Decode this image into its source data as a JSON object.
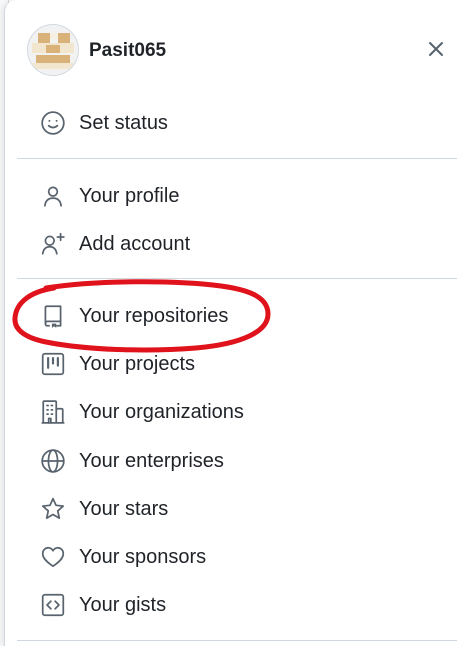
{
  "user": {
    "username": "Pasit065"
  },
  "menu": {
    "status": {
      "label": "Set status",
      "icon": "smiley-icon"
    },
    "section1": [
      {
        "label": "Your profile",
        "icon": "person-icon"
      },
      {
        "label": "Add account",
        "icon": "person-add-icon"
      }
    ],
    "section2": [
      {
        "label": "Your repositories",
        "icon": "repo-icon"
      },
      {
        "label": "Your projects",
        "icon": "project-icon"
      },
      {
        "label": "Your organizations",
        "icon": "organization-icon"
      },
      {
        "label": "Your enterprises",
        "icon": "globe-icon"
      },
      {
        "label": "Your stars",
        "icon": "star-icon"
      },
      {
        "label": "Your sponsors",
        "icon": "heart-icon"
      },
      {
        "label": "Your gists",
        "icon": "code-square-icon"
      }
    ]
  },
  "annotation": {
    "highlighted_item": "Your repositories",
    "color": "#e0121b"
  },
  "colors": {
    "icon": "#59636e",
    "divider": "#d0d7de",
    "text": "#1f2328"
  }
}
